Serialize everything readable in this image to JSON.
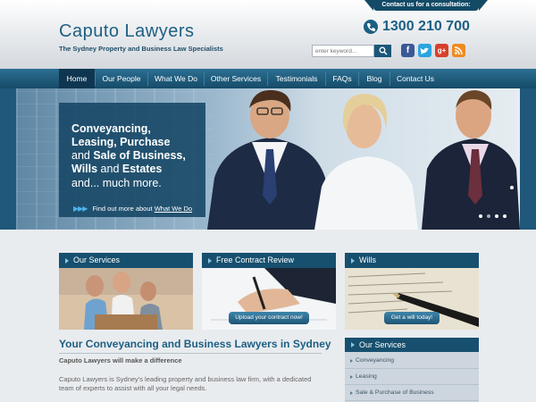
{
  "header": {
    "consult_label": "Contact us for a consultation:",
    "logo_title": "Caputo Lawyers",
    "tagline": "The Sydney Property and Business Law Specialists",
    "phone": "1300 210 700",
    "search_placeholder": "enter keyword...",
    "social": [
      "facebook-icon",
      "twitter-icon",
      "google-plus-icon",
      "rss-icon"
    ]
  },
  "nav": {
    "items": [
      "Home",
      "Our People",
      "What We Do",
      "Other Services",
      "Testimonials",
      "FAQs",
      "Blog",
      "Contact Us"
    ],
    "active": "Home"
  },
  "hero": {
    "line1": "Conveyancing,",
    "line2": "Leasing, Purchase",
    "line3_a": "and ",
    "line3_b": "Sale of Business,",
    "line4_a": "Wills",
    "line4_b": " and ",
    "line4_c": "Estates",
    "line5": "and... much more.",
    "link_prefix": "Find out more about ",
    "link_text": "What We Do"
  },
  "panels": [
    {
      "title": "Our Services",
      "button": ""
    },
    {
      "title": "Free Contract Review",
      "button": "Upload your contract now!"
    },
    {
      "title": "Wills",
      "button": "Get a will today!"
    }
  ],
  "main": {
    "heading": "Your Conveyancing and Business Lawyers in Sydney",
    "subheading": "Caputo Lawyers will make a difference",
    "body": "Caputo Lawyers is Sydney's leading property and business law firm, with a dedicated team of experts to assist with all your legal needs."
  },
  "sidebar": {
    "title": "Our Services",
    "items": [
      "Conveyancing",
      "Leasing",
      "Sale & Purchase of Business"
    ]
  },
  "colors": {
    "brand_blue": "#1d5f83",
    "nav_dark": "#164b68",
    "accent_light": "#4db3e8"
  }
}
